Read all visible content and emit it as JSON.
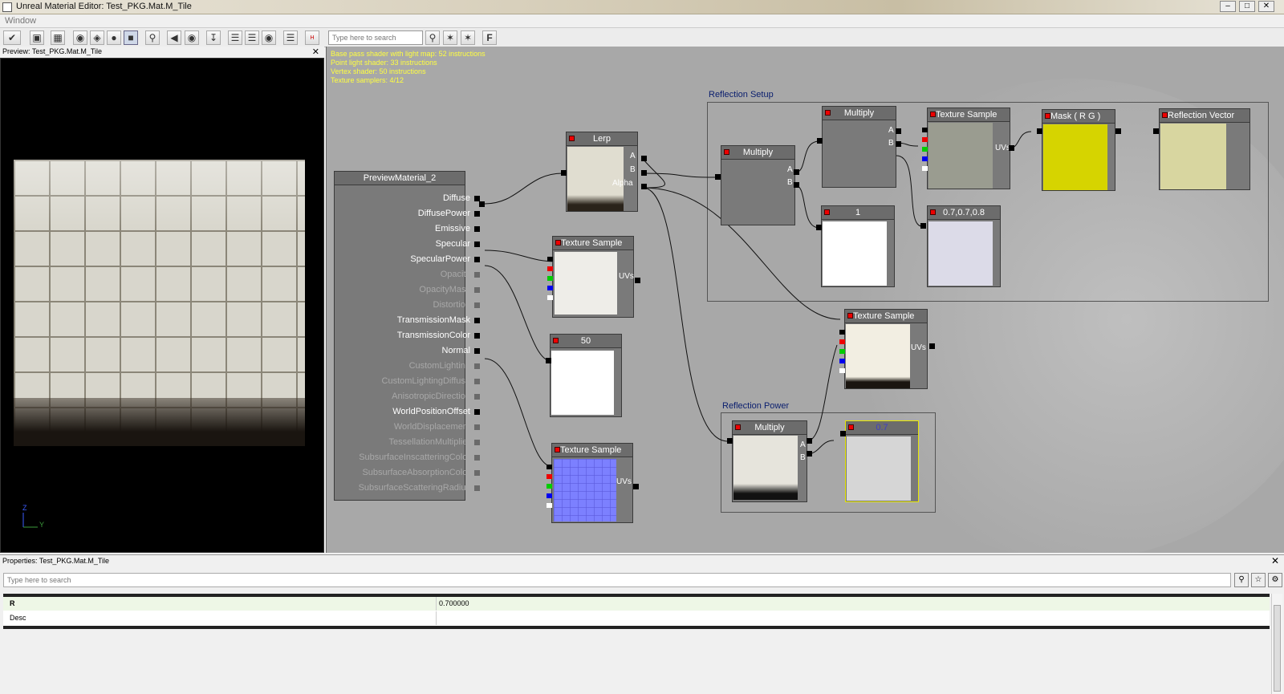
{
  "window": {
    "title": "Unreal Material Editor: Test_PKG.Mat.M_Tile",
    "menu": "Window"
  },
  "toolbar": {
    "search_placeholder": "Type here to search",
    "icons": [
      "apply-icon",
      "grid-icon",
      "grid2-icon",
      "sphere-icon",
      "cylinder-icon",
      "cube-icon",
      "plane-icon",
      "magnifier-icon",
      "back-icon",
      "home-icon",
      "realtime-icon",
      "layout-icon",
      "layout2-icon",
      "layout3-icon",
      "stats-icon",
      "hlsl-icon",
      "search-icon",
      "clean-icon",
      "flatten-icon",
      "f-icon"
    ]
  },
  "preview": {
    "title": "Preview: Test_PKG.Mat.M_Tile",
    "axis_z": "Z",
    "axis_y": "Y"
  },
  "graph": {
    "stats": [
      "Base pass shader with light map: 52 instructions",
      "Point light shader: 33 instructions",
      "Vertex shader: 50 instructions",
      "Texture samplers: 4/12"
    ],
    "comments": {
      "reflection_setup": "Reflection Setup",
      "reflection_power": "Reflection Power"
    },
    "material": {
      "title": "PreviewMaterial_2",
      "inputs": [
        {
          "label": "Diffuse",
          "on": true
        },
        {
          "label": "DiffusePower",
          "on": true
        },
        {
          "label": "Emissive",
          "on": true
        },
        {
          "label": "Specular",
          "on": true
        },
        {
          "label": "SpecularPower",
          "on": true
        },
        {
          "label": "Opacity",
          "on": false
        },
        {
          "label": "OpacityMask",
          "on": false
        },
        {
          "label": "Distortion",
          "on": false
        },
        {
          "label": "TransmissionMask",
          "on": true
        },
        {
          "label": "TransmissionColor",
          "on": true
        },
        {
          "label": "Normal",
          "on": true
        },
        {
          "label": "CustomLighting",
          "on": false
        },
        {
          "label": "CustomLightingDiffuse",
          "on": false
        },
        {
          "label": "AnisotropicDirection",
          "on": false
        },
        {
          "label": "WorldPositionOffset",
          "on": true
        },
        {
          "label": "WorldDisplacement",
          "on": false
        },
        {
          "label": "TessellationMultiplier",
          "on": false
        },
        {
          "label": "SubsurfaceInscatteringColor",
          "on": false
        },
        {
          "label": "SubsurfaceAbsorptionColor",
          "on": false
        },
        {
          "label": "SubsurfaceScatteringRadius",
          "on": false
        }
      ]
    },
    "nodes": {
      "lerp": {
        "title": "Lerp",
        "pin_a": "A",
        "pin_b": "B",
        "pin_alpha": "Alpha"
      },
      "tex_spec": {
        "title": "Texture Sample",
        "uvs": "UVs"
      },
      "const_50": {
        "title": "50"
      },
      "tex_normal": {
        "title": "Texture Sample",
        "uvs": "UVs"
      },
      "mul_setup": {
        "title": "Multiply",
        "pin_a": "A",
        "pin_b": "B"
      },
      "mul_top": {
        "title": "Multiply",
        "pin_a": "A",
        "pin_b": "B"
      },
      "const_1": {
        "title": "1"
      },
      "tex_refl": {
        "title": "Texture Sample",
        "uvs": "UVs"
      },
      "const_vec": {
        "title": "0.7,0.7,0.8"
      },
      "mask": {
        "title": "Mask ( R G )"
      },
      "refl_vec": {
        "title": "Reflection Vector"
      },
      "tex_mid": {
        "title": "Texture Sample",
        "uvs": "UVs"
      },
      "mul_power": {
        "title": "Multiply",
        "pin_a": "A",
        "pin_b": "B"
      },
      "const_07": {
        "title": "0.7"
      }
    }
  },
  "properties": {
    "title": "Properties: Test_PKG.Mat.M_Tile",
    "search_placeholder": "Type here to search",
    "rows": [
      {
        "key": "R",
        "value": "0.700000"
      },
      {
        "key": "Desc",
        "value": ""
      }
    ]
  }
}
